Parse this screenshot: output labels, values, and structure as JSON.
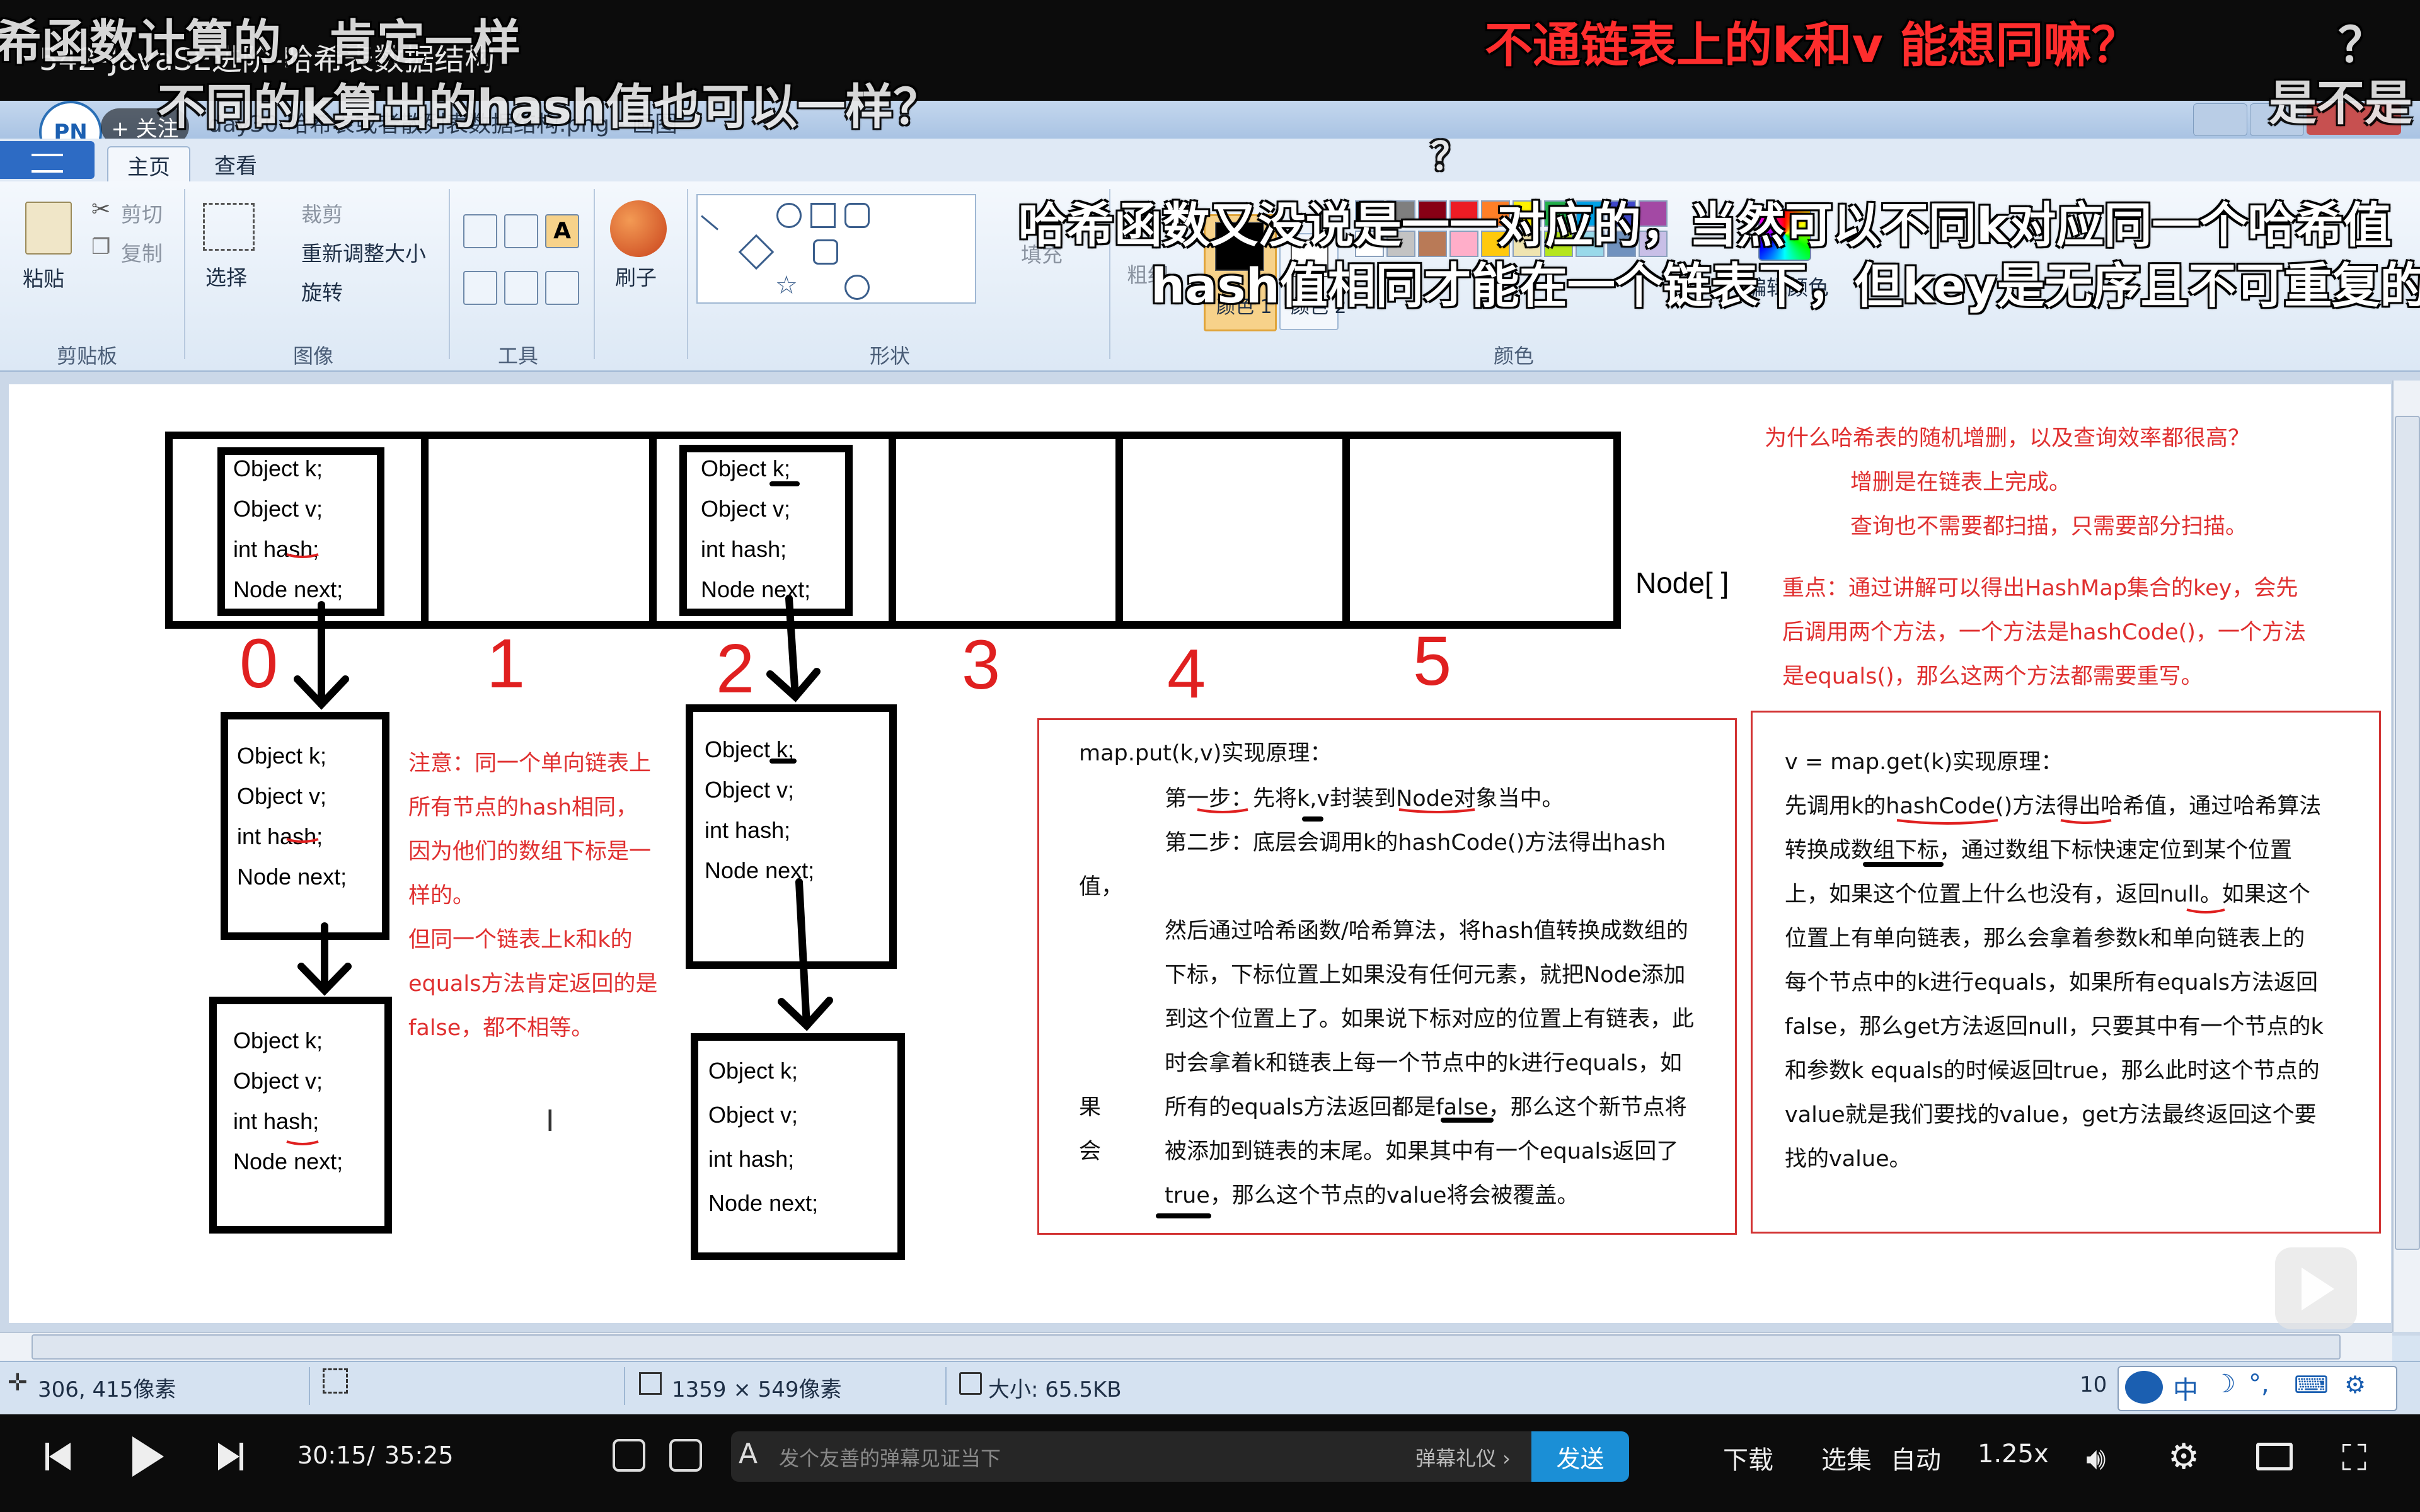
{
  "video": {
    "title": "542-JavaSE进阶-哈希表数据结构",
    "follow_label": "+ 关注",
    "uploader_logo": "PN",
    "time_current": "30:15",
    "time_separator": "/",
    "time_total": "35:25",
    "danmaku_placeholder": "发个友善的弹幕见证当下",
    "danmaku_etiquette": "弹幕礼仪 ›",
    "send_label": "发送",
    "download_label": "下载",
    "episodes_label": "选集",
    "quality_label": "自动",
    "speed_label": "1.25x"
  },
  "danmaku": [
    "希函数计算的，肯定一样",
    "不同的k算出的hash值也可以一样？",
    "不通链表上的k和v  能想同嘛？",
    "？",
    "是不是",
    "？",
    "哈希函数又没说是一一对应的，当然可以不同k对应同一个哈希值",
    "hash值相同才能在一个链表下，但key是无序且不可重复的"
  ],
  "paint": {
    "window_title": "day30-哈希表或者散列表数据结构.png - 画图",
    "tabs": [
      "主页",
      "查看"
    ],
    "clipboard": {
      "paste": "粘贴",
      "cut": "剪切",
      "copy": "复制",
      "group": "剪贴板"
    },
    "image": {
      "select": "选择",
      "crop": "裁剪",
      "resize": "重新调整大小",
      "rotate": "旋转",
      "group": "图像"
    },
    "tools": {
      "group": "工具"
    },
    "brushes": {
      "label": "刷子"
    },
    "shapes": {
      "fill": "填充",
      "group": "形状"
    },
    "colors": {
      "size": "粗细",
      "color1": "颜色 1",
      "color2": "颜色 2",
      "group": "颜色",
      "edit": "编辑颜色"
    },
    "status": {
      "cursor_pos": "306, 415像素",
      "image_size": "1359 × 549像素",
      "file_size": "大小: 65.5KB",
      "zoom_partial": "10"
    }
  },
  "diagram": {
    "array_label": "Node[ ]",
    "indices": [
      "0",
      "1",
      "2",
      "3",
      "4",
      "5"
    ],
    "node_fields": [
      "Object k;",
      "Object v;",
      "int hash;",
      "Node next;"
    ],
    "note_title": "为什么哈希表的随机增删，以及查询效率都很高？",
    "note_line1": "增删是在链表上完成。",
    "note_line2": "查询也不需要都扫描，只需要部分扫描。",
    "key_point": [
      "重点：通过讲解可以得出HashMap集合的key，会先",
      "后调用两个方法，一个方法是hashCode()，一个方法",
      "是equals()，那么这两个方法都需要重写。"
    ],
    "left_note": [
      "注意：同一个单向链表上",
      "所有节点的hash相同，",
      "因为他们的数组下标是一",
      "样的。",
      "但同一个链表上k和k的",
      "equals方法肯定返回的是",
      "false，都不相等。"
    ],
    "put_box": {
      "title": "map.put(k,v)实现原理：",
      "lines": [
        "第一步：先将k,v封装到Node对象当中。",
        "第二步：底层会调用k的hashCode()方法得出hash",
        "值，",
        "然后通过哈希函数/哈希算法，将hash值转换成数组的",
        "下标，下标位置上如果没有任何元素，就把Node添加",
        "到这个位置上了。如果说下标对应的位置上有链表，此",
        "时会拿着k和链表上每一个节点中的k进行equals，如",
        "所有的equals方法返回都是false，那么这个新节点将",
        "被添加到链表的末尾。如果其中有一个equals返回了",
        "true，那么这个节点的value将会被覆盖。"
      ],
      "side_chars": [
        "果",
        "会"
      ]
    },
    "get_box": {
      "title": "v = map.get(k)实现原理：",
      "lines": [
        "先调用k的hashCode()方法得出哈希值，通过哈希算法",
        "转换成数组下标，通过数组下标快速定位到某个位置",
        "上，如果这个位置上什么也没有，返回null。如果这个",
        "位置上有单向链表，那么会拿着参数k和单向链表上的",
        "每个节点中的k进行equals，如果所有equals方法返回",
        "false，那么get方法返回null，只要其中有一个节点的k",
        "和参数k  equals的时候返回true，那么此时这个节点的",
        "value就是我们要找的value，get方法最终返回这个要",
        "找的value。"
      ]
    }
  }
}
